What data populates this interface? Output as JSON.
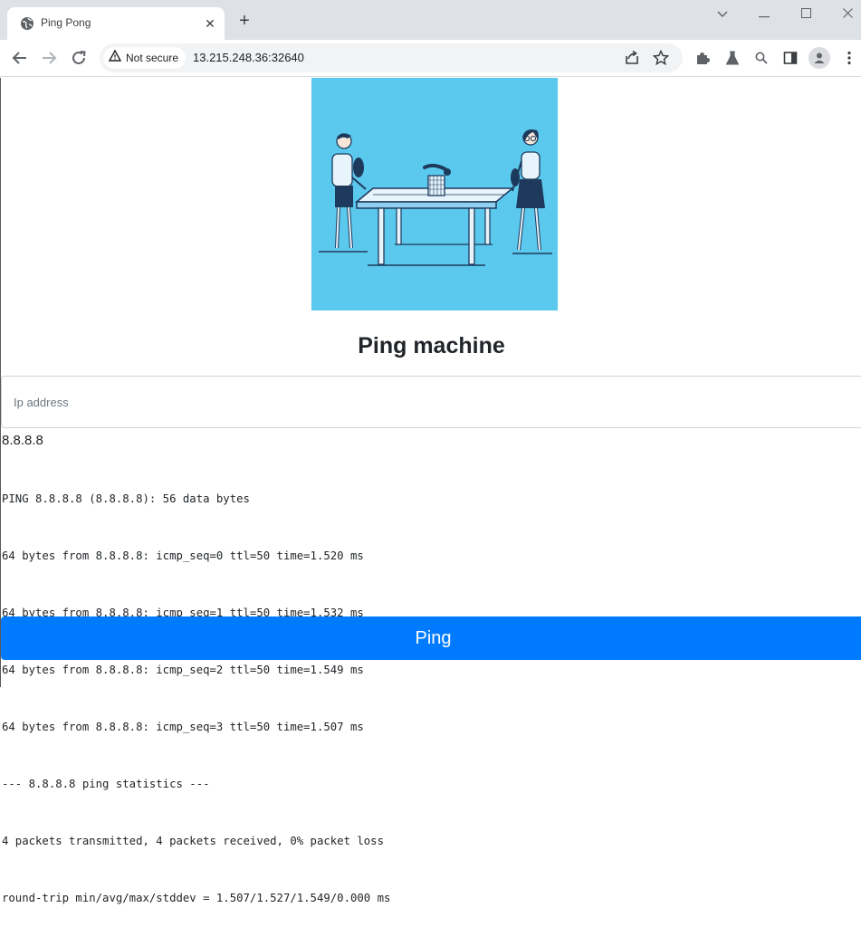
{
  "browser": {
    "tab_title": "Ping Pong",
    "security_label": "Not secure",
    "url": "13.215.248.36:32640"
  },
  "page": {
    "heading": "Ping machine",
    "ip_placeholder": "Ip address",
    "ip_value": "",
    "entered_ip": "8.8.8.8",
    "output_lines": [
      "PING 8.8.8.8 (8.8.8.8): 56 data bytes",
      "64 bytes from 8.8.8.8: icmp_seq=0 ttl=50 time=1.520 ms",
      "64 bytes from 8.8.8.8: icmp_seq=1 ttl=50 time=1.532 ms",
      "64 bytes from 8.8.8.8: icmp_seq=2 ttl=50 time=1.549 ms",
      "64 bytes from 8.8.8.8: icmp_seq=3 ttl=50 time=1.507 ms",
      "--- 8.8.8.8 ping statistics ---",
      "4 packets transmitted, 4 packets received, 0% packet loss",
      "round-trip min/avg/max/stddev = 1.507/1.527/1.549/0.000 ms"
    ],
    "ping_button": "Ping",
    "hero_image": "ping-pong-players-illustration"
  },
  "colors": {
    "primary": "#007bff",
    "hero_bg": "#5bc8ee"
  }
}
